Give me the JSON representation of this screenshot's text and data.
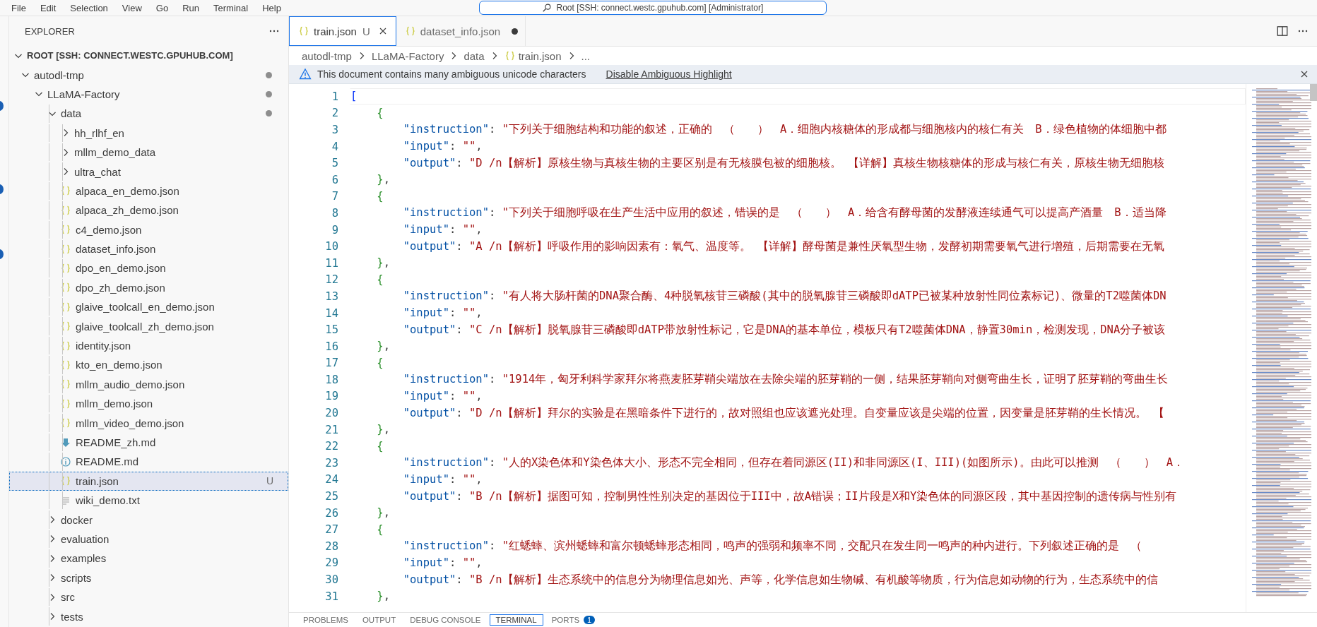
{
  "menu": [
    "File",
    "Edit",
    "Selection",
    "View",
    "Go",
    "Run",
    "Terminal",
    "Help"
  ],
  "command_center": "Root [SSH: connect.westc.gpuhub.com] [Administrator]",
  "explorer": {
    "title": "EXPLORER",
    "root": {
      "label": "ROOT [SSH: CONNECT.WESTC.GPUHUB.COM]",
      "expanded": true,
      "children": [
        {
          "label": "autodl-tmp",
          "kind": "folder",
          "expanded": true,
          "modified": true,
          "selected": false,
          "children": [
            {
              "label": "LLaMA-Factory",
              "kind": "folder",
              "expanded": true,
              "modified": true,
              "selected": false,
              "children": [
                {
                  "label": "data",
                  "kind": "folder",
                  "expanded": true,
                  "modified": true,
                  "selected": false,
                  "children": [
                    {
                      "label": "hh_rlhf_en",
                      "kind": "folder",
                      "expanded": false,
                      "modified": false,
                      "selected": false
                    },
                    {
                      "label": "mllm_demo_data",
                      "kind": "folder",
                      "expanded": false,
                      "modified": false,
                      "selected": false
                    },
                    {
                      "label": "ultra_chat",
                      "kind": "folder",
                      "expanded": false,
                      "modified": false,
                      "selected": false
                    },
                    {
                      "label": "alpaca_en_demo.json",
                      "kind": "json",
                      "modified": false,
                      "selected": false
                    },
                    {
                      "label": "alpaca_zh_demo.json",
                      "kind": "json",
                      "modified": false,
                      "selected": false
                    },
                    {
                      "label": "c4_demo.json",
                      "kind": "json",
                      "modified": false,
                      "selected": false
                    },
                    {
                      "label": "dataset_info.json",
                      "kind": "json",
                      "modified": false,
                      "selected": false
                    },
                    {
                      "label": "dpo_en_demo.json",
                      "kind": "json",
                      "modified": false,
                      "selected": false
                    },
                    {
                      "label": "dpo_zh_demo.json",
                      "kind": "json",
                      "modified": false,
                      "selected": false
                    },
                    {
                      "label": "glaive_toolcall_en_demo.json",
                      "kind": "json",
                      "modified": false,
                      "selected": false
                    },
                    {
                      "label": "glaive_toolcall_zh_demo.json",
                      "kind": "json",
                      "modified": false,
                      "selected": false
                    },
                    {
                      "label": "identity.json",
                      "kind": "json",
                      "modified": false,
                      "selected": false
                    },
                    {
                      "label": "kto_en_demo.json",
                      "kind": "json",
                      "modified": false,
                      "selected": false
                    },
                    {
                      "label": "mllm_audio_demo.json",
                      "kind": "json",
                      "modified": false,
                      "selected": false
                    },
                    {
                      "label": "mllm_demo.json",
                      "kind": "json",
                      "modified": false,
                      "selected": false
                    },
                    {
                      "label": "mllm_video_demo.json",
                      "kind": "json",
                      "modified": false,
                      "selected": false
                    },
                    {
                      "label": "README_zh.md",
                      "kind": "markdown",
                      "modified": false,
                      "selected": false
                    },
                    {
                      "label": "README.md",
                      "kind": "info",
                      "modified": false,
                      "selected": false
                    },
                    {
                      "label": "train.json",
                      "kind": "json",
                      "modified": false,
                      "selected": true,
                      "badge": "U"
                    },
                    {
                      "label": "wiki_demo.txt",
                      "kind": "text",
                      "modified": false,
                      "selected": false
                    }
                  ]
                },
                {
                  "label": "docker",
                  "kind": "folder",
                  "expanded": false,
                  "modified": false,
                  "selected": false
                },
                {
                  "label": "evaluation",
                  "kind": "folder",
                  "expanded": false,
                  "modified": false,
                  "selected": false
                },
                {
                  "label": "examples",
                  "kind": "folder",
                  "expanded": false,
                  "modified": false,
                  "selected": false
                },
                {
                  "label": "scripts",
                  "kind": "folder",
                  "expanded": false,
                  "modified": false,
                  "selected": false
                },
                {
                  "label": "src",
                  "kind": "folder",
                  "expanded": false,
                  "modified": false,
                  "selected": false
                },
                {
                  "label": "tests",
                  "kind": "folder",
                  "expanded": false,
                  "modified": false,
                  "selected": false
                }
              ]
            }
          ]
        }
      ]
    }
  },
  "tabs": [
    {
      "label": "train.json",
      "status": "U",
      "selected": true,
      "dirty": false
    },
    {
      "label": "dataset_info.json",
      "selected": false,
      "dirty": true
    }
  ],
  "breadcrumbs": [
    {
      "label": "autodl-tmp",
      "kind": "folder"
    },
    {
      "label": "LLaMA-Factory",
      "kind": "folder"
    },
    {
      "label": "data",
      "kind": "folder"
    },
    {
      "label": "train.json",
      "kind": "json"
    },
    {
      "label": "...",
      "kind": "more"
    }
  ],
  "banner": {
    "message": "This document contains many ambiguous unicode characters",
    "action": "Disable Ambiguous Highlight"
  },
  "code": [
    {
      "number": "1",
      "text": "[",
      "current": true
    },
    {
      "number": "2",
      "text": "    {",
      "current": false
    },
    {
      "number": "3",
      "text": "        \"instruction\": \"下列关于细胞结构和功能的叙述，正确的　（　　）　A．细胞内核糖体的形成都与细胞核内的核仁有关　B．绿色植物的体细胞中都",
      "current": false
    },
    {
      "number": "4",
      "text": "        \"input\": \"\",",
      "current": false
    },
    {
      "number": "5",
      "text": "        \"output\": \"D /n【解析】原核生物与真核生物的主要区别是有无核膜包被的细胞核。 【详解】真核生物核糖体的形成与核仁有关，原核生物无细胞核",
      "current": false
    },
    {
      "number": "6",
      "text": "    },",
      "current": false
    },
    {
      "number": "7",
      "text": "    {",
      "current": false
    },
    {
      "number": "8",
      "text": "        \"instruction\": \"下列关于细胞呼吸在生产生活中应用的叙述，错误的是　（　　）　A．给含有酵母菌的发酵液连续通气可以提高产酒量　B．适当降",
      "current": false
    },
    {
      "number": "9",
      "text": "        \"input\": \"\",",
      "current": false
    },
    {
      "number": "10",
      "text": "        \"output\": \"A /n【解析】呼吸作用的影响因素有：氧气、温度等。 【详解】酵母菌是兼性厌氧型生物，发酵初期需要氧气进行增殖，后期需要在无氧",
      "current": false
    },
    {
      "number": "11",
      "text": "    },",
      "current": false
    },
    {
      "number": "12",
      "text": "    {",
      "current": false
    },
    {
      "number": "13",
      "text": "        \"instruction\": \"有人将大肠杆菌的DNA聚合酶、4种脱氧核苷三磷酸(其中的脱氧腺苷三磷酸即dATP已被某种放射性同位素标记)、微量的T2噬菌体DN",
      "current": false
    },
    {
      "number": "14",
      "text": "        \"input\": \"\",",
      "current": false
    },
    {
      "number": "15",
      "text": "        \"output\": \"C /n【解析】脱氧腺苷三磷酸即dATP带放射性标记，它是DNA的基本单位，模板只有T2噬菌体DNA，静置30min，检测发现，DNA分子被该",
      "current": false
    },
    {
      "number": "16",
      "text": "    },",
      "current": false
    },
    {
      "number": "17",
      "text": "    {",
      "current": false
    },
    {
      "number": "18",
      "text": "        \"instruction\": \"1914年，匈牙利科学家拜尔将燕麦胚芽鞘尖端放在去除尖端的胚芽鞘的一侧，结果胚芽鞘向对侧弯曲生长，证明了胚芽鞘的弯曲生长",
      "current": false
    },
    {
      "number": "19",
      "text": "        \"input\": \"\",",
      "current": false
    },
    {
      "number": "20",
      "text": "        \"output\": \"D /n【解析】拜尔的实验是在黑暗条件下进行的，故对照组也应该遮光处理。自变量应该是尖端的位置，因变量是胚芽鞘的生长情况。 【",
      "current": false
    },
    {
      "number": "21",
      "text": "    },",
      "current": false
    },
    {
      "number": "22",
      "text": "    {",
      "current": false
    },
    {
      "number": "23",
      "text": "        \"instruction\": \"人的X染色体和Y染色体大小、形态不完全相同，但存在着同源区(II)和非同源区(I、III)(如图所示)。由此可以推测　（　　）　A．",
      "current": false
    },
    {
      "number": "24",
      "text": "        \"input\": \"\",",
      "current": false
    },
    {
      "number": "25",
      "text": "        \"output\": \"B /n【解析】据图可知，控制男性性别决定的基因位于III中，故A错误；II片段是X和Y染色体的同源区段，其中基因控制的遗传病与性别有",
      "current": false
    },
    {
      "number": "26",
      "text": "    },",
      "current": false
    },
    {
      "number": "27",
      "text": "    {",
      "current": false
    },
    {
      "number": "28",
      "text": "        \"instruction\": \"红蟋蟀、滨州蟋蟀和富尔顿蟋蟀形态相同，鸣声的强弱和频率不同，交配只在发生同一鸣声的种内进行。下列叙述正确的是　（",
      "current": false
    },
    {
      "number": "29",
      "text": "        \"input\": \"\",",
      "current": false
    },
    {
      "number": "30",
      "text": "        \"output\": \"B /n【解析】生态系统中的信息分为物理信息如光、声等，化学信息如生物碱、有机酸等物质，行为信息如动物的行为，生态系统中的信",
      "current": false
    },
    {
      "number": "31",
      "text": "    },",
      "current": false
    }
  ],
  "panel_tabs": [
    {
      "label": "PROBLEMS",
      "selected": false
    },
    {
      "label": "OUTPUT",
      "selected": false
    },
    {
      "label": "DEBUG CONSOLE",
      "selected": false
    },
    {
      "label": "TERMINAL",
      "selected": true
    },
    {
      "label": "PORTS",
      "selected": false,
      "badge": "1"
    }
  ]
}
